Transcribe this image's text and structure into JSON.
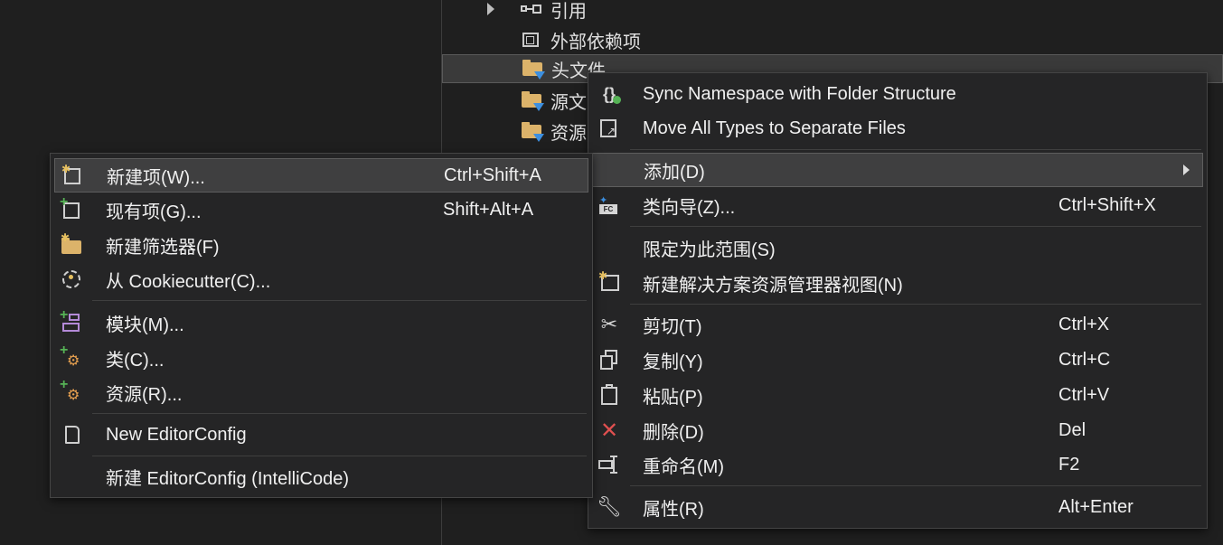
{
  "tree": {
    "items": [
      {
        "label": "引用"
      },
      {
        "label": "外部依赖项"
      },
      {
        "label": "头文件"
      },
      {
        "label": "源文"
      },
      {
        "label": "资源"
      }
    ]
  },
  "context_menu": {
    "items": [
      {
        "label": "Sync Namespace with Folder Structure",
        "shortcut": "",
        "icon": "namespace-sync-icon"
      },
      {
        "label": "Move All Types to Separate Files",
        "shortcut": "",
        "icon": "move-types-icon"
      },
      {
        "label": "添加(D)",
        "shortcut": "",
        "icon": ""
      },
      {
        "label": "类向导(Z)...",
        "shortcut": "Ctrl+Shift+X",
        "icon": "class-wizard-icon"
      },
      {
        "label": "限定为此范围(S)",
        "shortcut": "",
        "icon": ""
      },
      {
        "label": "新建解决方案资源管理器视图(N)",
        "shortcut": "",
        "icon": "new-view-icon"
      },
      {
        "label": "剪切(T)",
        "shortcut": "Ctrl+X",
        "icon": "cut-icon"
      },
      {
        "label": "复制(Y)",
        "shortcut": "Ctrl+C",
        "icon": "copy-icon"
      },
      {
        "label": "粘贴(P)",
        "shortcut": "Ctrl+V",
        "icon": "paste-icon"
      },
      {
        "label": "删除(D)",
        "shortcut": "Del",
        "icon": "delete-icon"
      },
      {
        "label": "重命名(M)",
        "shortcut": "F2",
        "icon": "rename-icon"
      },
      {
        "label": "属性(R)",
        "shortcut": "Alt+Enter",
        "icon": "wrench-icon"
      }
    ]
  },
  "add_submenu": {
    "items": [
      {
        "label": "新建项(W)...",
        "shortcut": "Ctrl+Shift+A",
        "icon": "new-item-icon"
      },
      {
        "label": "现有项(G)...",
        "shortcut": "Shift+Alt+A",
        "icon": "existing-item-icon"
      },
      {
        "label": "新建筛选器(F)",
        "shortcut": "",
        "icon": "new-filter-icon"
      },
      {
        "label": "从 Cookiecutter(C)...",
        "shortcut": "",
        "icon": "cookiecutter-icon"
      },
      {
        "label": "模块(M)...",
        "shortcut": "",
        "icon": "module-icon"
      },
      {
        "label": "类(C)...",
        "shortcut": "",
        "icon": "class-icon"
      },
      {
        "label": "资源(R)...",
        "shortcut": "",
        "icon": "resource-icon"
      },
      {
        "label": "New EditorConfig",
        "shortcut": "",
        "icon": "file-icon"
      },
      {
        "label": "新建 EditorConfig (IntelliCode)",
        "shortcut": "",
        "icon": ""
      }
    ]
  },
  "colors": {
    "background": "#1f1f1f",
    "menu_bg": "#252526",
    "highlight": "#3f3f40",
    "folder": "#dcb36a",
    "accent_blue": "#3c8fe0",
    "delete_red": "#e05050",
    "add_green": "#56b356"
  }
}
